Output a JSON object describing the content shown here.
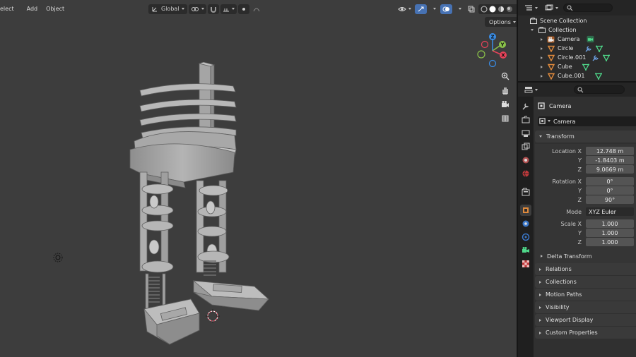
{
  "viewport": {
    "menus": [
      "elect",
      "Add",
      "Object"
    ],
    "transform_orientation": "Global",
    "options_label": "Options",
    "gizmo_axes": {
      "x": "X",
      "y": "Y",
      "z": "Z"
    }
  },
  "outliner": {
    "scene_collection": "Scene Collection",
    "collection": "Collection",
    "items": [
      {
        "name": "Camera",
        "type": "camera"
      },
      {
        "name": "Circle",
        "type": "mesh"
      },
      {
        "name": "Circle.001",
        "type": "mesh"
      },
      {
        "name": "Cube",
        "type": "mesh"
      },
      {
        "name": "Cube.001",
        "type": "mesh"
      }
    ]
  },
  "properties": {
    "object_title": "Camera",
    "object_name": "Camera",
    "transform": {
      "title": "Transform",
      "location_label": "Location X",
      "location": [
        "12.748 m",
        "-1.8403 m",
        "9.0669 m"
      ],
      "rotation_label": "Rotation X",
      "rotation": [
        "0°",
        "0°",
        "90°"
      ],
      "mode_label": "Mode",
      "mode": "XYZ Euler",
      "scale_label": "Scale X",
      "scale": [
        "1.000",
        "1.000",
        "1.000"
      ],
      "axis_y": "Y",
      "axis_z": "Z",
      "delta": "Delta Transform"
    },
    "panels": [
      "Relations",
      "Collections",
      "Motion Paths",
      "Visibility",
      "Viewport Display",
      "Custom Properties"
    ]
  },
  "colors": {
    "viewport_bg": "#3d3d3d",
    "accent": "#4772b3",
    "mesh_icon": "#e08a3c",
    "data_icon": "#4fd88a",
    "modifier_icon": "#6ea3e6",
    "axis_x": "#e8435a",
    "axis_y": "#8bc34a",
    "axis_z": "#3a8ee8"
  }
}
